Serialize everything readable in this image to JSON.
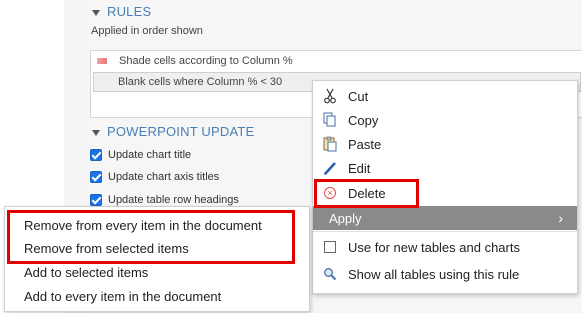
{
  "rules_section": {
    "title": "RULES",
    "subtitle": "Applied in order shown",
    "items": [
      {
        "label": "Shade cells according to Column %"
      },
      {
        "label": "Blank cells where Column % < 30"
      }
    ]
  },
  "powerpoint_section": {
    "title": "POWERPOINT UPDATE",
    "options": [
      {
        "label": "Update chart title",
        "checked": true
      },
      {
        "label": "Update chart axis titles",
        "checked": true
      },
      {
        "label": "Update table row headings",
        "checked": true
      }
    ]
  },
  "context_menu": {
    "cut": "Cut",
    "copy": "Copy",
    "paste": "Paste",
    "edit": "Edit",
    "delete": "Delete",
    "apply": "Apply",
    "apply_chevron": "›",
    "use_for_new": "Use for new tables and charts",
    "show_all": "Show all tables using this rule"
  },
  "apply_submenu": {
    "items": [
      "Remove from every item in the document",
      "Remove from selected items",
      "Add to selected items",
      "Add to every item in the document"
    ]
  },
  "icons": {
    "cut": "scissors-icon",
    "copy": "copy-icon",
    "paste": "paste-icon",
    "edit": "pencil-icon",
    "delete": "delete-circle-icon",
    "show_all": "magnifier-icon"
  },
  "colors": {
    "accent": "#4a7fb5",
    "highlight_red": "#e00000",
    "apply_bg": "#8a8a8a",
    "checkbox_blue": "#1a73e8"
  }
}
